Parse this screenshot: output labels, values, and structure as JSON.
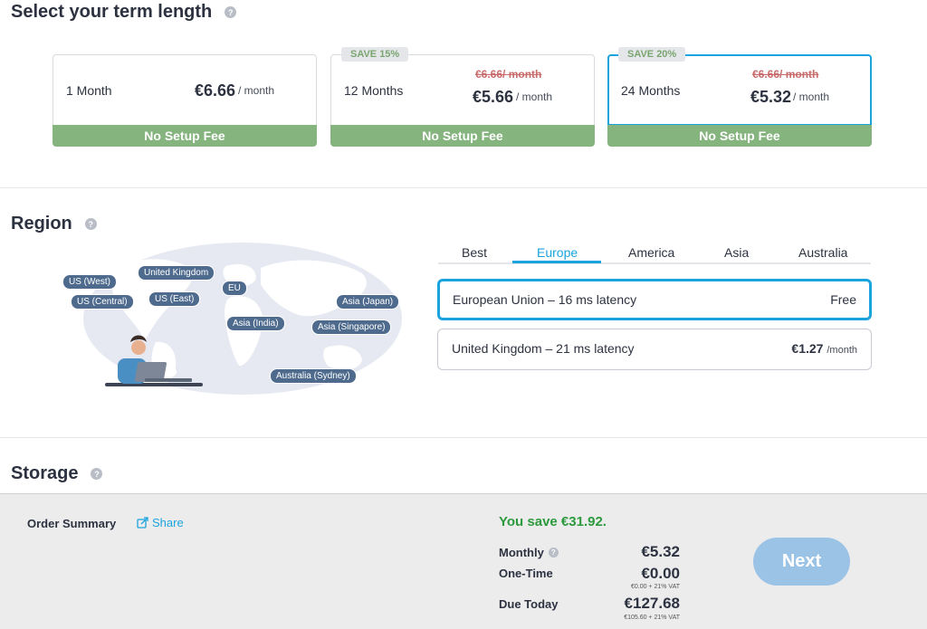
{
  "term": {
    "title": "Select your term length",
    "help": "?",
    "options": [
      {
        "name": "1 Month",
        "price": "€6.66",
        "unit": "/ month",
        "old_price": "",
        "badge": "",
        "fee": "No Setup Fee"
      },
      {
        "name": "12 Months",
        "price": "€5.66",
        "unit": "/ month",
        "old_price": "€6.66/ month",
        "badge": "SAVE 15%",
        "fee": "No Setup Fee"
      },
      {
        "name": "24 Months",
        "price": "€5.32",
        "unit": "/ month",
        "old_price": "€6.66/ month",
        "badge": "SAVE 20%",
        "fee": "No Setup Fee",
        "selected": true
      }
    ]
  },
  "region": {
    "title": "Region",
    "help": "?",
    "map_labels": [
      "US (West)",
      "United Kingdom",
      "US (Central)",
      "US (East)",
      "EU",
      "Asia (Japan)",
      "Asia (India)",
      "Asia (Singapore)",
      "Australia (Sydney)"
    ],
    "tabs": [
      "Best",
      "Europe",
      "America",
      "Asia",
      "Australia"
    ],
    "active_tab": "Europe",
    "options": [
      {
        "name": "European Union – 16 ms latency",
        "price": "Free",
        "unit": "",
        "selected": true
      },
      {
        "name": "United Kingdom – 21 ms latency",
        "price": "€1.27",
        "unit": "/month"
      }
    ]
  },
  "storage": {
    "title": "Storage",
    "help": "?"
  },
  "summary": {
    "title": "Order Summary",
    "share": "Share",
    "you_save": "You save €31.92.",
    "monthly_label": "Monthly",
    "monthly_value": "€5.32",
    "onetime_label": "One-Time",
    "onetime_value": "€0.00",
    "onetime_note": "€0.00 + 21% VAT",
    "due_label": "Due Today",
    "due_value": "€127.68",
    "due_note": "€105.60 + 21% VAT",
    "next": "Next"
  },
  "colors": {
    "accent": "#1ba3dd",
    "fee_green": "#86b47f",
    "save_green": "#2c9a3c",
    "strike_red": "#c86a6a",
    "next_button": "#9bc3e6"
  }
}
